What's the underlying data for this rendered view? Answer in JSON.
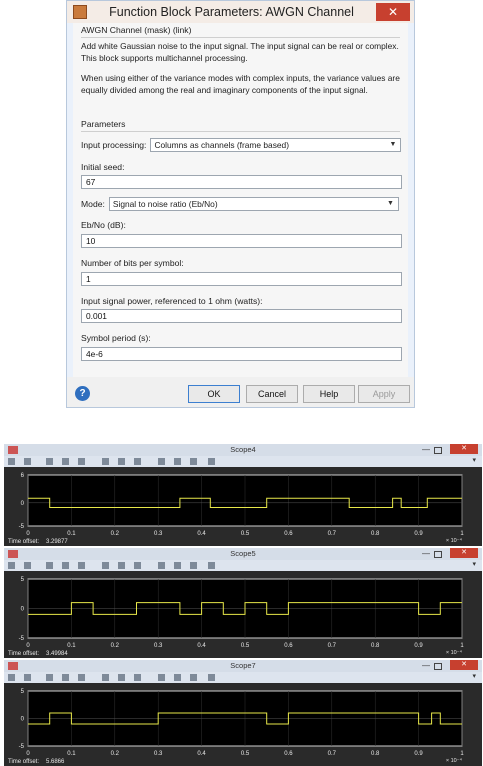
{
  "dialog": {
    "title": "Function Block Parameters: AWGN Channel",
    "close_label": "✕",
    "block_title": "AWGN Channel (mask) (link)",
    "description_1": "Add white Gaussian noise to the input signal. The input signal can be real or complex. This block supports multichannel processing.",
    "description_2": "When using either of the variance modes with complex inputs, the variance values are equally divided among the real and imaginary components of the input signal.",
    "parameters_heading": "Parameters",
    "input_processing_label": "Input processing:",
    "input_processing_value": "Columns as channels (frame based)",
    "initial_seed_label": "Initial seed:",
    "initial_seed_value": "67",
    "mode_label": "Mode:",
    "mode_value": "Signal to noise ratio  (Eb/No)",
    "ebno_label": "Eb/No (dB):",
    "ebno_value": "10",
    "bits_label": "Number of bits per symbol:",
    "bits_value": "1",
    "power_label": "Input signal power, referenced to 1 ohm (watts):",
    "power_value": "0.001",
    "symbol_period_label": "Symbol period (s):",
    "symbol_period_value": "4e-6",
    "buttons": {
      "ok": "OK",
      "cancel": "Cancel",
      "help": "Help",
      "apply": "Apply"
    },
    "help_icon": "?"
  },
  "scopes": [
    {
      "title": "Scope4",
      "time_offset_label": "Time offset:",
      "time_offset": "3.29877",
      "y_ticks": [
        "6",
        "0",
        "-5"
      ]
    },
    {
      "title": "Scope5",
      "time_offset_label": "Time offset:",
      "time_offset": "3.49984",
      "y_ticks": [
        "5",
        "0",
        "-5"
      ]
    },
    {
      "title": "Scope7",
      "time_offset_label": "Time offset:",
      "time_offset": "5.6866",
      "y_ticks": [
        "5",
        "0",
        "-5"
      ]
    }
  ],
  "x_ticks": [
    "0",
    "0.1",
    "0.2",
    "0.3",
    "0.4",
    "0.5",
    "0.6",
    "0.7",
    "0.8",
    "0.9",
    "1"
  ],
  "x_exponent": "× 10⁻⁴",
  "signal_color": "#e8e84a",
  "chart_data": [
    {
      "type": "line",
      "title": "Scope4",
      "xlim": [
        0,
        1
      ],
      "ylim": [
        -5,
        6
      ],
      "series": [
        {
          "x": [
            0,
            0.05,
            0.05,
            0.35,
            0.35,
            0.42,
            0.42,
            0.55,
            0.55,
            0.74,
            0.74,
            0.84,
            0.84,
            0.86,
            0.86,
            0.92,
            0.92,
            1.0
          ],
          "y": [
            1,
            1,
            -1,
            -1,
            1,
            1,
            -1,
            -1,
            1,
            1,
            -1,
            -1,
            1,
            1,
            -1,
            -1,
            1,
            1
          ]
        }
      ]
    },
    {
      "type": "line",
      "title": "Scope5",
      "xlim": [
        0,
        1
      ],
      "ylim": [
        -5,
        5
      ],
      "series": [
        {
          "x": [
            0,
            0.1,
            0.1,
            0.15,
            0.15,
            0.25,
            0.25,
            0.35,
            0.35,
            0.4,
            0.4,
            0.45,
            0.45,
            0.5,
            0.5,
            0.55,
            0.55,
            0.6,
            0.6,
            0.9,
            0.9,
            0.95,
            0.95,
            1.0
          ],
          "y": [
            -1,
            -1,
            1,
            1,
            -1,
            -1,
            1,
            1,
            -1,
            -1,
            1,
            1,
            -1,
            -1,
            1,
            1,
            -1,
            -1,
            1,
            1,
            -1,
            -1,
            1,
            1
          ]
        }
      ]
    },
    {
      "type": "line",
      "title": "Scope7",
      "xlim": [
        0,
        1
      ],
      "ylim": [
        -5,
        5
      ],
      "series": [
        {
          "x": [
            0,
            0.05,
            0.05,
            0.1,
            0.1,
            0.3,
            0.3,
            0.55,
            0.55,
            0.6,
            0.6,
            0.9,
            0.9,
            0.93,
            0.93,
            0.95,
            0.95,
            1.0
          ],
          "y": [
            -1,
            -1,
            1,
            1,
            -1,
            -1,
            1,
            1,
            -1,
            -1,
            1,
            1,
            -1,
            -1,
            1,
            1,
            -1,
            -1
          ]
        }
      ]
    }
  ]
}
